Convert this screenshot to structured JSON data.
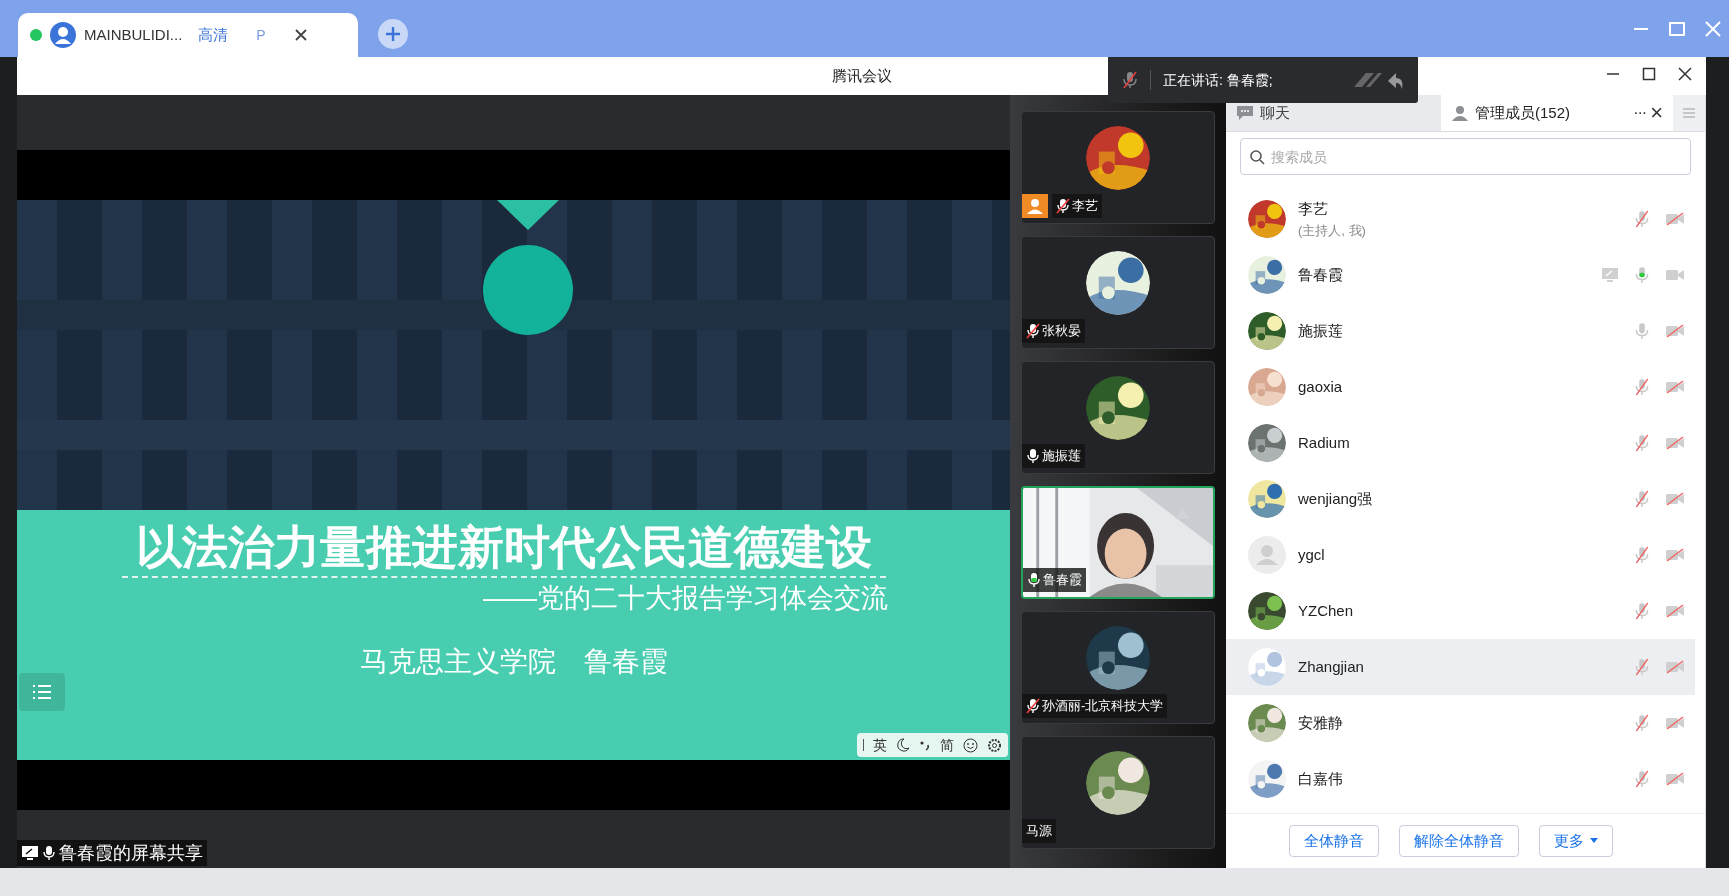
{
  "browser_tab": {
    "title": "MAINBULIDI...",
    "quality": "高清",
    "badge": "P"
  },
  "window": {
    "title": "腾讯会议"
  },
  "speaking": {
    "text": "正在讲话: 鲁春霞;"
  },
  "slide": {
    "title": "以法治力量推进新时代公民道德建设",
    "subtitle": "——党的二十大报告学习体会交流",
    "author": "马克思主义学院　鲁春霞",
    "ime": [
      "英",
      "简"
    ]
  },
  "share_label": "鲁春霞的屏幕共享",
  "tiles": [
    {
      "name": "李艺",
      "kind": "avatar",
      "mic_shown": true,
      "muted": true,
      "speaking": false,
      "host": true,
      "active": false
    },
    {
      "name": "张秋晏",
      "kind": "avatar",
      "mic_shown": true,
      "muted": true,
      "speaking": false,
      "host": false,
      "active": false
    },
    {
      "name": "施振莲",
      "kind": "avatar",
      "mic_shown": true,
      "muted": false,
      "speaking": false,
      "host": false,
      "active": false
    },
    {
      "name": "鲁春霞",
      "kind": "video",
      "mic_shown": true,
      "muted": false,
      "speaking": true,
      "host": false,
      "active": true
    },
    {
      "name": "孙酒丽-北京科技大学",
      "kind": "avatar",
      "mic_shown": true,
      "muted": true,
      "speaking": false,
      "host": false,
      "active": false
    },
    {
      "name": "马源",
      "kind": "avatar",
      "mic_shown": false,
      "host": false,
      "active": false
    }
  ],
  "panel": {
    "tabs": [
      {
        "label": "聊天",
        "selected": false
      },
      {
        "label": "管理成员(152)",
        "selected": true
      }
    ],
    "more": "···",
    "close": "×",
    "search": {
      "placeholder": "搜索成员"
    },
    "members": [
      {
        "name": "李艺",
        "note": "(主持人, 我)",
        "muted": true,
        "speaking": false,
        "camera_on": false,
        "sharing": false,
        "selected": false,
        "default_avatar": false
      },
      {
        "name": "鲁春霞",
        "muted": false,
        "speaking": true,
        "camera_on": true,
        "sharing": true,
        "selected": false,
        "default_avatar": false
      },
      {
        "name": "施振莲",
        "muted": false,
        "speaking": false,
        "camera_on": false,
        "sharing": false,
        "selected": false,
        "default_avatar": false
      },
      {
        "name": "gaoxia",
        "muted": true,
        "speaking": false,
        "camera_on": false,
        "sharing": false,
        "selected": false,
        "default_avatar": false
      },
      {
        "name": "Radium",
        "muted": true,
        "speaking": false,
        "camera_on": false,
        "sharing": false,
        "selected": false,
        "default_avatar": false
      },
      {
        "name": "wenjiang强",
        "muted": true,
        "speaking": false,
        "camera_on": false,
        "sharing": false,
        "selected": false,
        "default_avatar": false
      },
      {
        "name": "ygcl",
        "muted": true,
        "speaking": false,
        "camera_on": false,
        "sharing": false,
        "selected": false,
        "default_avatar": true
      },
      {
        "name": "YZChen",
        "muted": true,
        "speaking": false,
        "camera_on": false,
        "sharing": false,
        "selected": false,
        "default_avatar": false
      },
      {
        "name": "Zhangjian",
        "muted": true,
        "speaking": false,
        "camera_on": false,
        "sharing": false,
        "selected": true,
        "default_avatar": false
      },
      {
        "name": "安雅静",
        "muted": true,
        "speaking": false,
        "camera_on": false,
        "sharing": false,
        "selected": false,
        "default_avatar": false
      },
      {
        "name": "白嘉伟",
        "muted": true,
        "speaking": false,
        "camera_on": false,
        "sharing": false,
        "selected": false,
        "default_avatar": false
      }
    ],
    "buttons": [
      {
        "label": "全体静音",
        "kind": "plain"
      },
      {
        "label": "解除全体静音",
        "kind": "plain"
      },
      {
        "label": "更多",
        "kind": "dropdown"
      }
    ]
  }
}
